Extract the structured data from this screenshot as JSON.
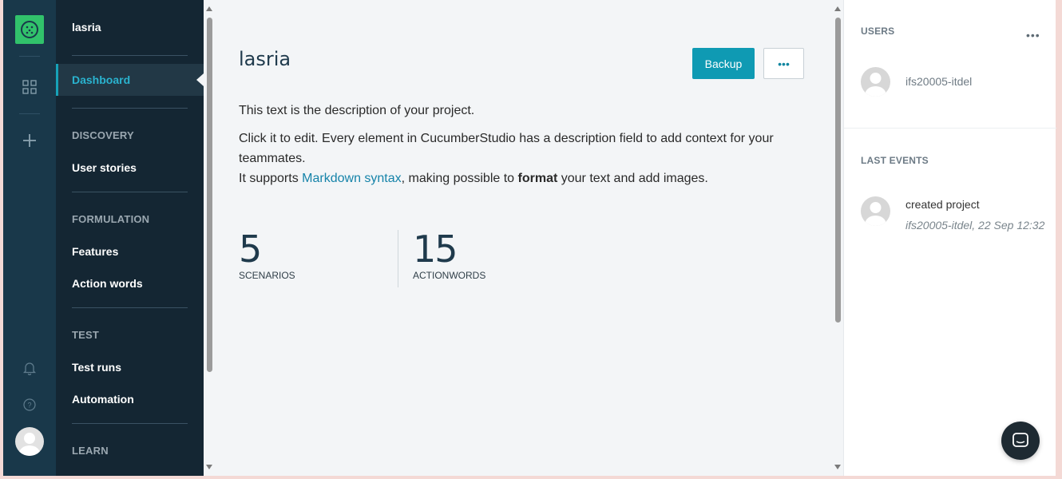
{
  "rail": {
    "icons": [
      "cucumber-logo-icon",
      "grid-icon",
      "plus-icon",
      "bell-icon",
      "help-icon",
      "avatar"
    ]
  },
  "nav": {
    "project_name": "lasria",
    "active_item": "Dashboard",
    "sections": [
      {
        "label": "DISCOVERY",
        "items": [
          "User stories"
        ]
      },
      {
        "label": "FORMULATION",
        "items": [
          "Features",
          "Action words"
        ]
      },
      {
        "label": "TEST",
        "items": [
          "Test runs",
          "Automation"
        ]
      },
      {
        "label": "LEARN",
        "items": []
      }
    ]
  },
  "main": {
    "title": "lasria",
    "backup_label": "Backup",
    "more_label": "•••",
    "description": {
      "line1": "This text is the description of your project.",
      "line2": "Click it to edit. Every element in CucumberStudio has a description field to add context for your teammates.",
      "line3_pre": "It supports ",
      "line3_link": "Markdown syntax",
      "line3_mid": ", making possible to ",
      "line3_bold": "format",
      "line3_post": " your text and add images."
    },
    "stats": [
      {
        "value": "5",
        "label": "SCENARIOS"
      },
      {
        "value": "15",
        "label": "ACTIONWORDS"
      }
    ]
  },
  "right": {
    "users_heading": "USERS",
    "more_label": "•••",
    "users": [
      "ifs20005-itdel"
    ],
    "events_heading": "LAST EVENTS",
    "events": [
      {
        "text": "created project",
        "meta": "ifs20005-itdel, 22 Sep 12:32"
      }
    ]
  },
  "colors": {
    "accent": "#0f9ab3",
    "rail_bg": "#19384a",
    "nav_bg": "#142633",
    "logo_green": "#31c26b"
  }
}
